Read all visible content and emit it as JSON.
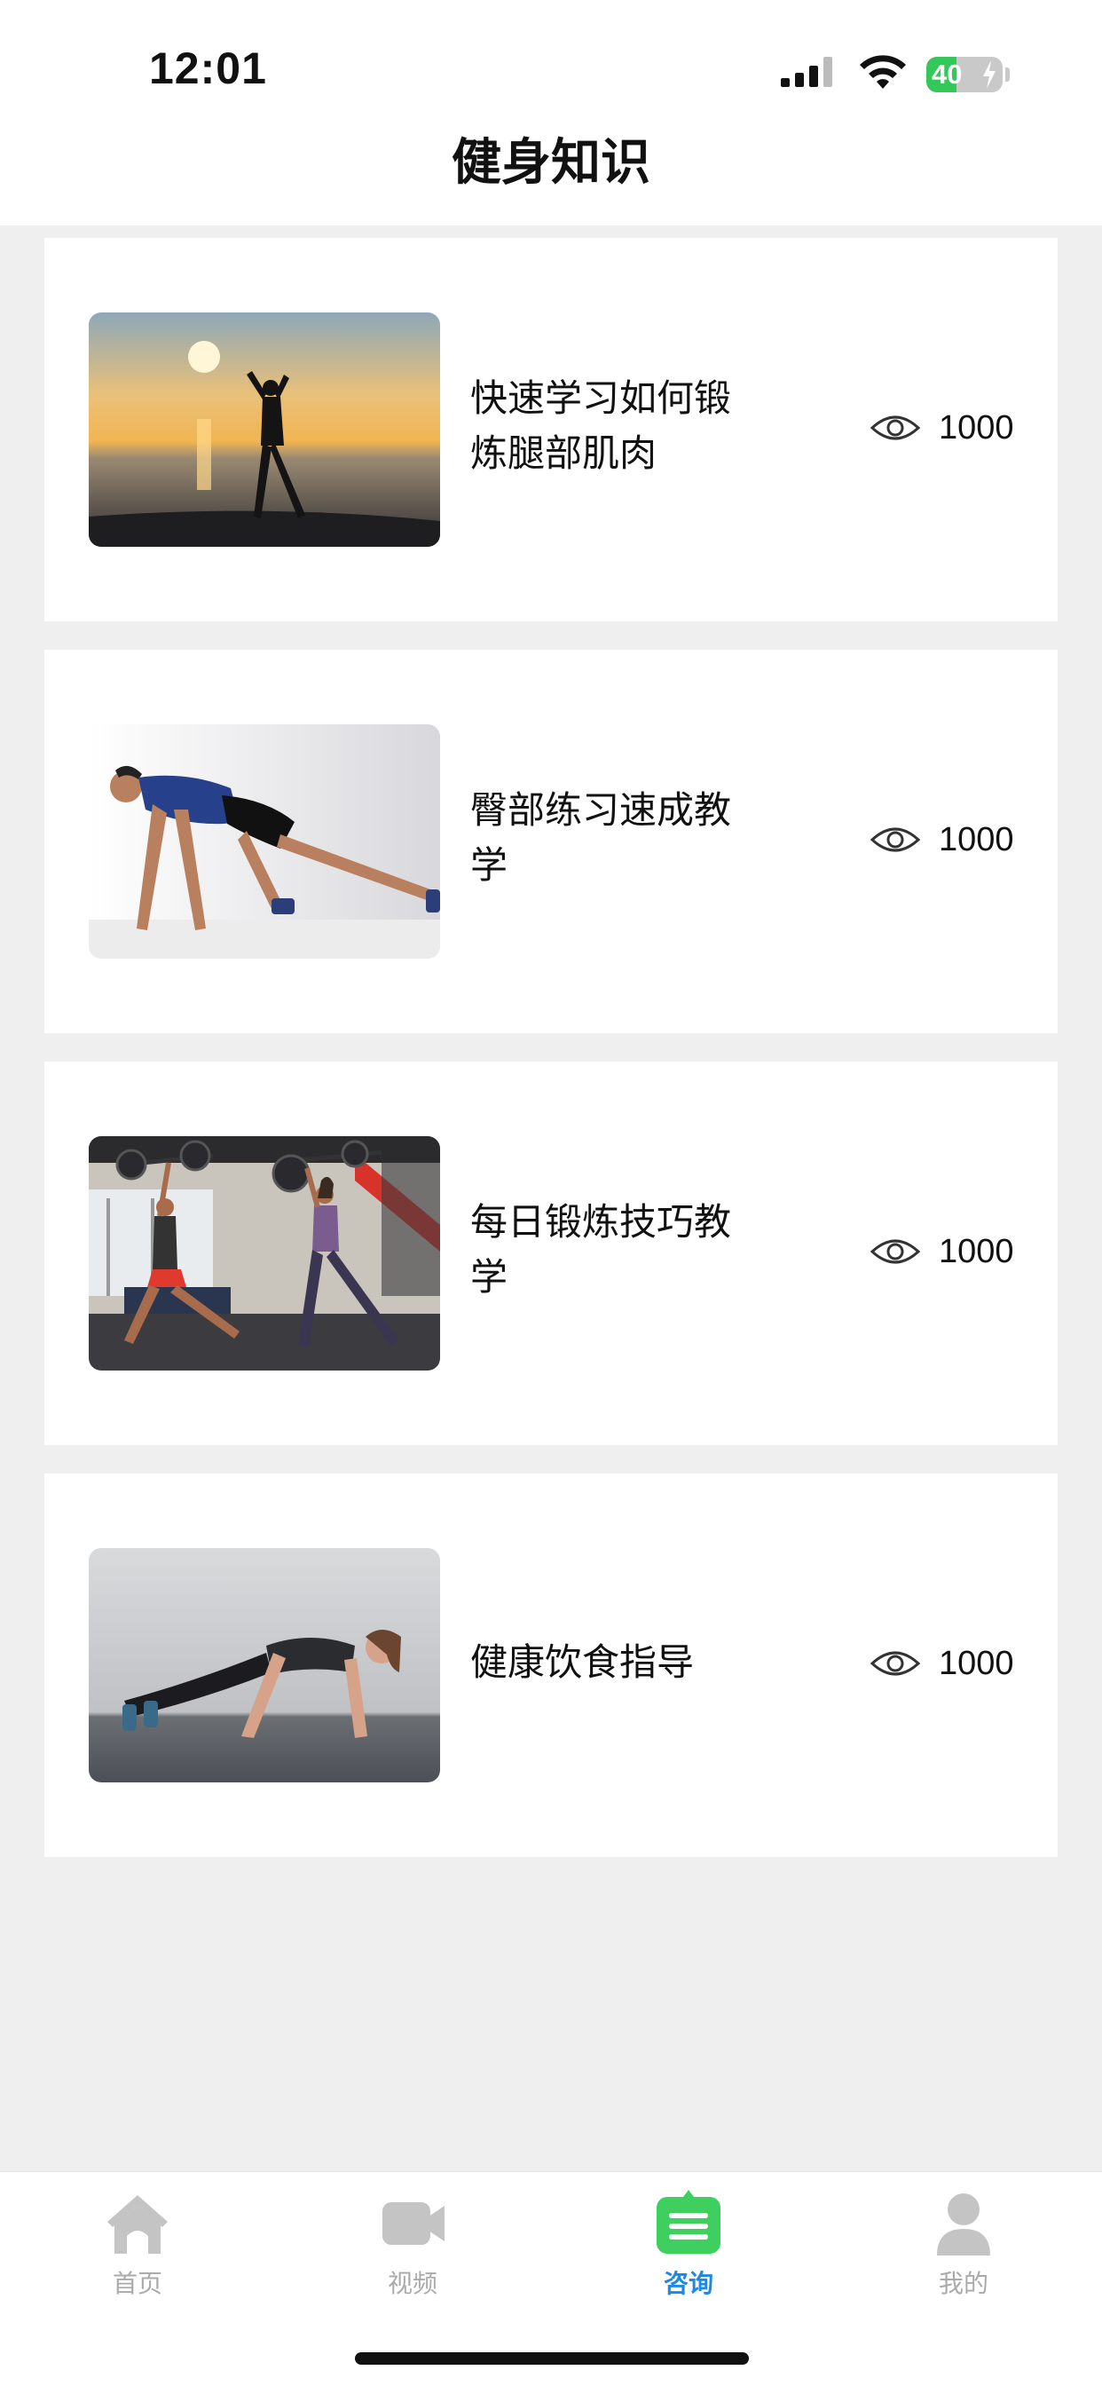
{
  "status_bar": {
    "time": "12:01",
    "battery_level": "40",
    "battery_fraction": 0.4,
    "icons": [
      "signal-icon",
      "wifi-icon",
      "battery-charging-icon"
    ]
  },
  "header": {
    "title": "健身知识"
  },
  "articles": [
    {
      "title": "快速学习如何锻炼腿部肌肉",
      "views": "1000",
      "image": "sunset-stretch-photo"
    },
    {
      "title": "臀部练习速成教学",
      "views": "1000",
      "image": "man-lunge-photo"
    },
    {
      "title": "每日锻炼技巧教学",
      "views": "1000",
      "image": "gym-barbell-photo"
    },
    {
      "title": "健康饮食指导",
      "views": "1000",
      "image": "woman-pushup-photo"
    }
  ],
  "tabbar": {
    "items": [
      {
        "label": "首页",
        "icon": "home-icon",
        "active": false
      },
      {
        "label": "视频",
        "icon": "video-icon",
        "active": false
      },
      {
        "label": "咨询",
        "icon": "consult-icon",
        "active": true
      },
      {
        "label": "我的",
        "icon": "user-icon",
        "active": false
      }
    ]
  },
  "colors": {
    "background": "#efefef",
    "active_tab": "#1e88e5",
    "active_icon": "#3ecf5e",
    "inactive": "#aaaaaa",
    "battery": "#34c759"
  }
}
